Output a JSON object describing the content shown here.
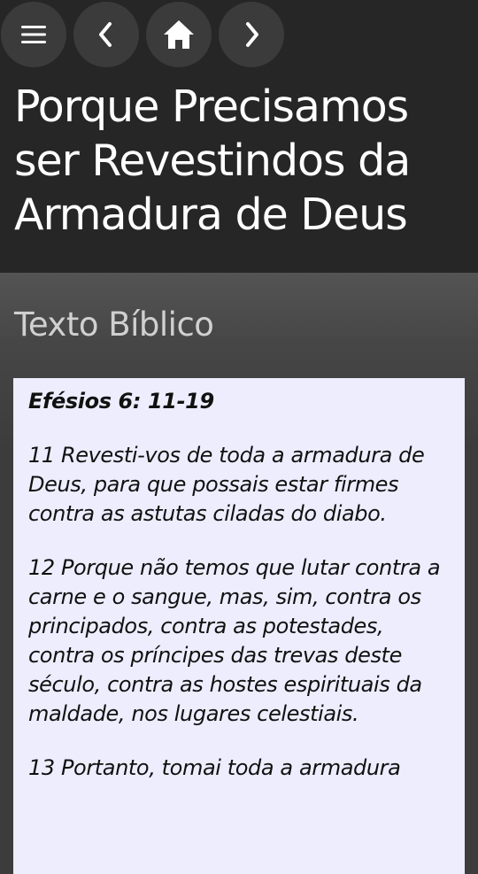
{
  "header": {
    "title": "Porque Precisamos ser Revestindos da Armadura de Deus",
    "buttons": {
      "menu_icon": "hamburger-menu-icon",
      "back_icon": "chevron-left-icon",
      "home_icon": "home-icon",
      "forward_icon": "chevron-right-icon"
    }
  },
  "content": {
    "section_title": "Texto Bíblico",
    "reference": "Efésios 6: 11-19",
    "verses": [
      "11 Revesti-vos de toda a armadura de Deus, para que possais estar firmes contra as astutas ciladas do diabo.",
      "12 Porque não temos que lutar contra a carne e o sangue, mas, sim, contra os principados, contra as potestades, contra os príncipes das trevas deste século, contra as hostes espirituais da maldade, nos lugares celestiais.",
      "13 Portanto, tomai toda a armadura"
    ]
  },
  "colors": {
    "header_bg": "#262626",
    "button_bg": "#3b3b3b",
    "content_bg": "#3c3c3c",
    "text_box_bg": "#ededfe",
    "section_title": "#d0d0d0"
  }
}
